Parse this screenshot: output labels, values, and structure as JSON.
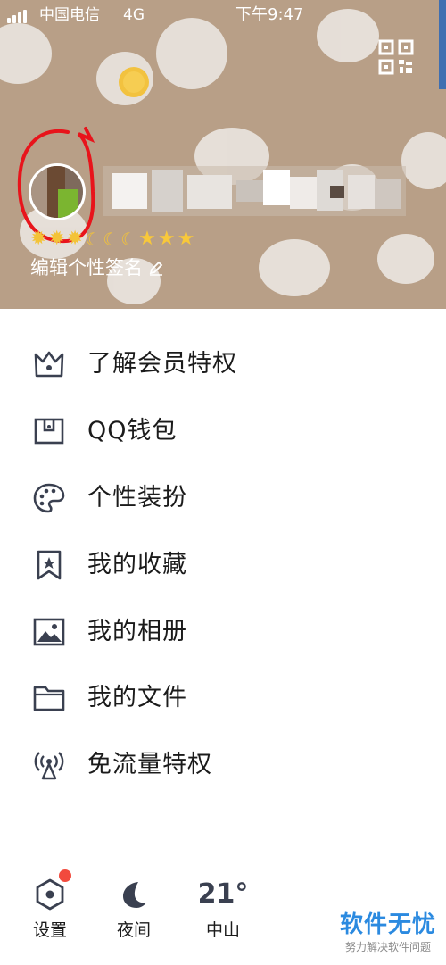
{
  "status_bar": {
    "carrier": "中国电信",
    "network": "4G",
    "time": "下午9:47"
  },
  "profile": {
    "level_icons": [
      "sun",
      "sun",
      "sun",
      "moon",
      "moon",
      "moon",
      "star",
      "star",
      "star"
    ],
    "signature_placeholder": "编辑个性签名"
  },
  "menu": {
    "items": [
      {
        "label": "了解会员特权",
        "icon": "crown-icon"
      },
      {
        "label": "QQ钱包",
        "icon": "wallet-icon"
      },
      {
        "label": "个性装扮",
        "icon": "palette-icon"
      },
      {
        "label": "我的收藏",
        "icon": "bookmark-star-icon"
      },
      {
        "label": "我的相册",
        "icon": "photo-icon"
      },
      {
        "label": "我的文件",
        "icon": "folder-icon"
      },
      {
        "label": "免流量特权",
        "icon": "signal-tower-icon"
      }
    ]
  },
  "bottom_bar": {
    "settings_label": "设置",
    "night_label": "夜间",
    "temperature": "21°",
    "city": "中山"
  },
  "watermark": {
    "title": "软件无忧",
    "subtitle": "努力解决软件问题"
  },
  "colors": {
    "header_bg": "#b89f87",
    "badge": "#f24a3d",
    "icon": "#3a4050",
    "annotation": "#e8141b",
    "watermark": "#2b8ae0"
  }
}
